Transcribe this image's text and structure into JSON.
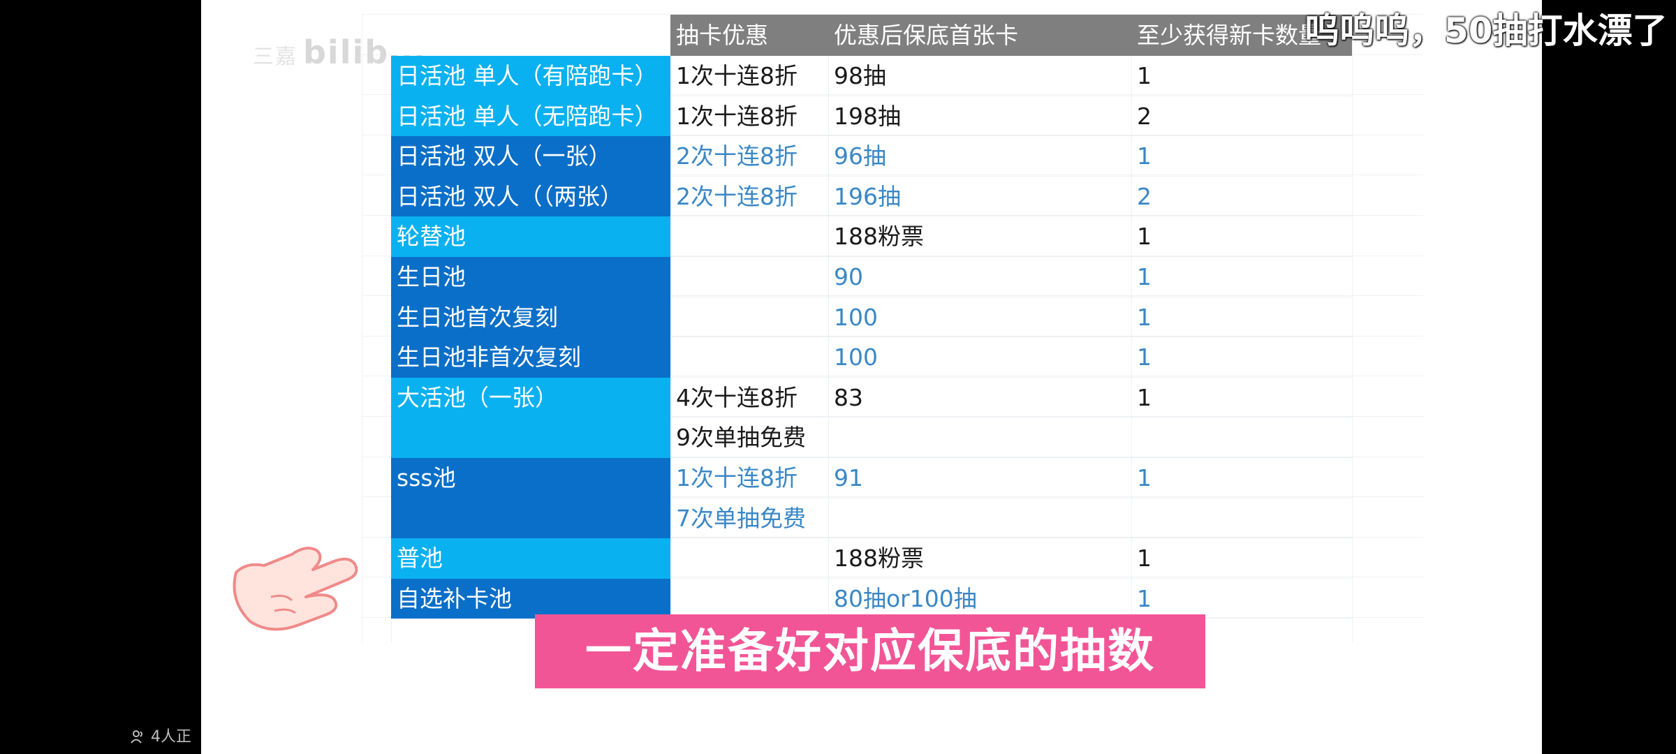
{
  "watermark": {
    "text": "三嘉",
    "logo": "bilibili"
  },
  "table": {
    "headers": [
      "抽卡优惠",
      "优惠后保底首张卡",
      "至少获得新卡数量"
    ],
    "rows": [
      {
        "pool": "日活池 单人（有陪跑卡）",
        "discount": "1次十连8折",
        "pity": "98抽",
        "min_cards": "1"
      },
      {
        "pool": "日活池 单人（无陪跑卡）",
        "discount": "1次十连8折",
        "pity": "198抽",
        "min_cards": "2"
      },
      {
        "pool": "日活池 双人（一张）",
        "discount": "2次十连8折",
        "pity": "96抽",
        "min_cards": "1"
      },
      {
        "pool": "日活池 双人（（两张）",
        "discount": "2次十连8折",
        "pity": "196抽",
        "min_cards": "2"
      },
      {
        "pool": "轮替池",
        "discount": "",
        "pity": "188粉票",
        "min_cards": "1"
      },
      {
        "pool": "生日池",
        "discount": "",
        "pity": "90",
        "min_cards": "1"
      },
      {
        "pool": "生日池首次复刻",
        "discount": "",
        "pity": "100",
        "min_cards": "1"
      },
      {
        "pool": "生日池非首次复刻",
        "discount": "",
        "pity": "100",
        "min_cards": "1"
      },
      {
        "pool": "大活池（一张）",
        "discount": "4次十连8折",
        "pity": "83",
        "min_cards": "1"
      },
      {
        "pool": "",
        "discount": "9次单抽免费",
        "pity": "",
        "min_cards": ""
      },
      {
        "pool": "sss池",
        "discount": "1次十连8折",
        "pity": "91",
        "min_cards": "1"
      },
      {
        "pool": "",
        "discount": "7次单抽免费",
        "pity": "",
        "min_cards": ""
      },
      {
        "pool": "普池",
        "discount": "",
        "pity": "188粉票",
        "min_cards": "1"
      },
      {
        "pool": "自选补卡池",
        "discount": "",
        "pity": "80抽or100抽",
        "min_cards": "1"
      }
    ]
  },
  "caption": "一定准备好对应保底的抽数",
  "viewer_count": "4人正",
  "danmaku": "呜呜呜，50抽打水漂了",
  "colors": {
    "header_bg": "#7f7f7f",
    "pool_light": "#0ab1f0",
    "pool_dark": "#0a6fc8",
    "text_blue": "#3a87c6",
    "caption_bg": "#f25596"
  }
}
